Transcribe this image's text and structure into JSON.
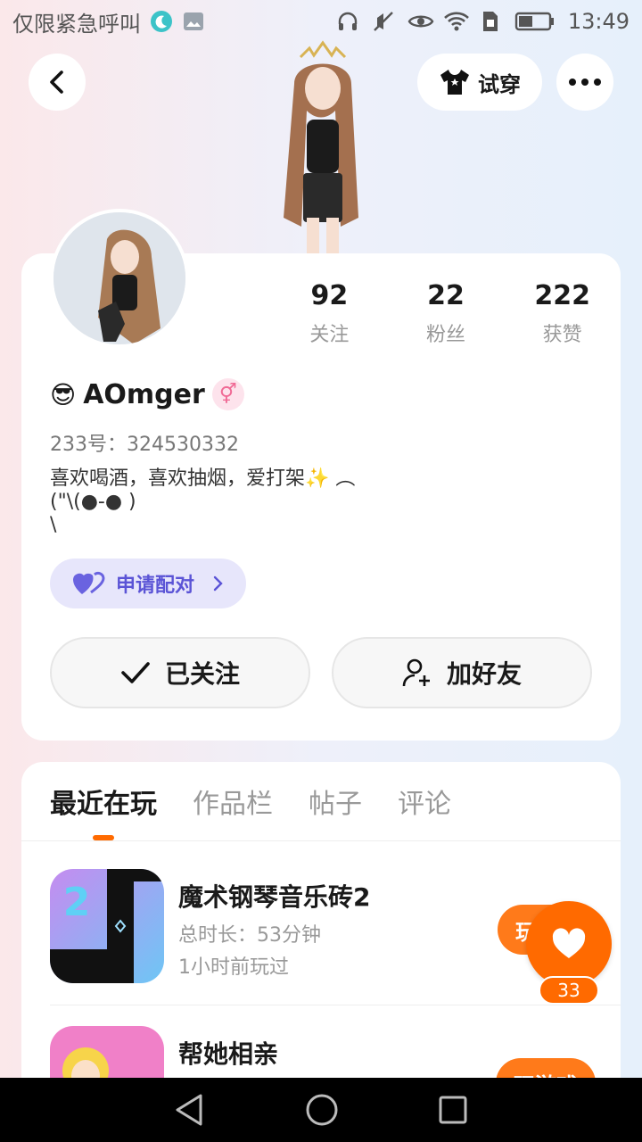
{
  "status_bar": {
    "left_text": "仅限紧急呼叫",
    "time": "13:49"
  },
  "header": {
    "tryon_label": "试穿"
  },
  "profile": {
    "stats": [
      {
        "value": "92",
        "label": "关注"
      },
      {
        "value": "22",
        "label": "粉丝"
      },
      {
        "value": "222",
        "label": "获赞"
      }
    ],
    "name_prefix_emoji": "😎",
    "name": "AOmger",
    "gender_symbol": "⚥",
    "uid": "233号：324530332",
    "bio": "喜欢喝酒，喜欢抽烟，爱打架✨ ︵\n(\"\\(●-● )\n\\",
    "pair_label": "申请配对",
    "followed_label": "已关注",
    "add_friend_label": "加好友"
  },
  "tabs": [
    {
      "label": "最近在玩",
      "active": true
    },
    {
      "label": "作品栏",
      "active": false
    },
    {
      "label": "帖子",
      "active": false
    },
    {
      "label": "评论",
      "active": false
    }
  ],
  "games": [
    {
      "title": "魔术钢琴音乐砖2",
      "duration": "总时长：53分钟",
      "last_played": "1小时前玩过",
      "button": "玩"
    },
    {
      "title": "帮她相亲",
      "button": "玩游戏"
    }
  ],
  "like": {
    "count": "33"
  },
  "colors": {
    "accent": "#ff6a00",
    "pair_bg": "#e7e6fb",
    "pair_text": "#5b54d6"
  }
}
